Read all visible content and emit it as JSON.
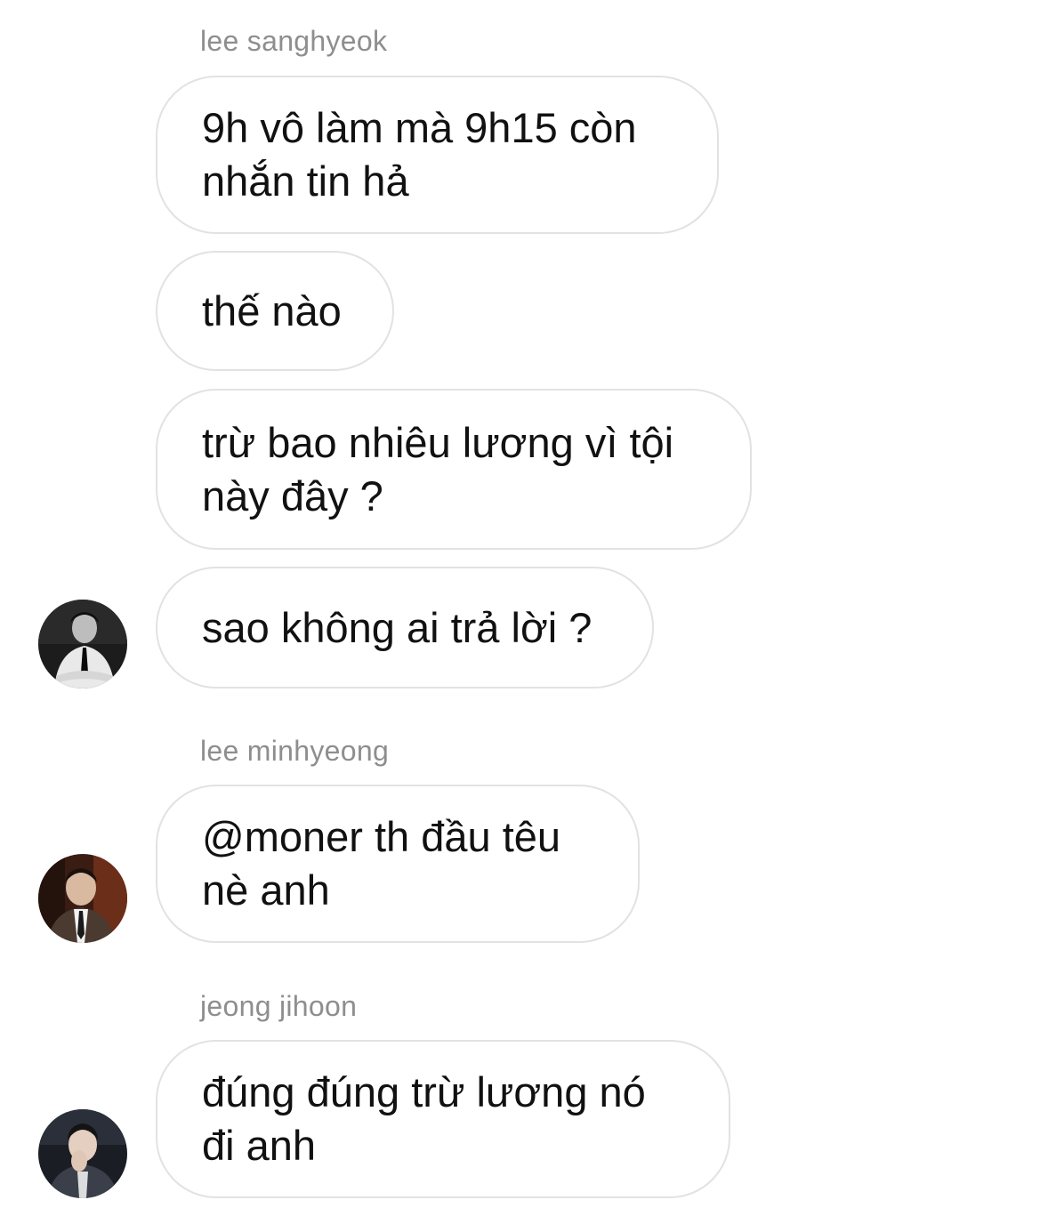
{
  "thread": {
    "groups": [
      {
        "sender": "lee sanghyeok",
        "avatar_icon": "avatar-lee-sanghyeok",
        "messages": [
          "9h vô làm mà 9h15 còn nhắn tin hả",
          "thế nào",
          "trừ bao nhiêu lương vì tội này đây ?",
          "sao không ai trả lời ?"
        ]
      },
      {
        "sender": "lee minhyeong",
        "avatar_icon": "avatar-lee-minhyeong",
        "messages": [
          "@moner th đầu têu nè anh"
        ]
      },
      {
        "sender": "jeong jihoon",
        "avatar_icon": "avatar-jeong-jihoon",
        "messages": [
          "đúng đúng trừ lương nó đi anh"
        ]
      }
    ]
  },
  "colors": {
    "background": "#ffffff",
    "bubble_border": "#e2e2e2",
    "sender_text": "#8e8e8e",
    "message_text": "#111111"
  }
}
